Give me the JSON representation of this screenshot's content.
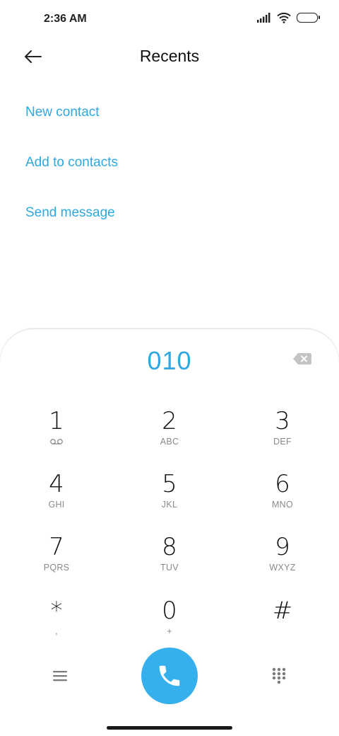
{
  "status_bar": {
    "time": "2:36 AM",
    "icons": [
      "signal-icon",
      "wifi-icon",
      "battery-icon"
    ]
  },
  "header": {
    "back_icon": "back-arrow-icon",
    "title": "Recents"
  },
  "actions": [
    {
      "label": "New contact"
    },
    {
      "label": "Add to contacts"
    },
    {
      "label": "Send message"
    }
  ],
  "dialer": {
    "number": "010",
    "backspace_icon": "backspace-icon",
    "keys": [
      {
        "digit": "1",
        "letters": "",
        "icon": "voicemail-icon"
      },
      {
        "digit": "2",
        "letters": "ABC"
      },
      {
        "digit": "3",
        "letters": "DEF"
      },
      {
        "digit": "4",
        "letters": "GHI"
      },
      {
        "digit": "5",
        "letters": "JKL"
      },
      {
        "digit": "6",
        "letters": "MNO"
      },
      {
        "digit": "7",
        "letters": "PQRS"
      },
      {
        "digit": "8",
        "letters": "TUV"
      },
      {
        "digit": "9",
        "letters": "WXYZ"
      },
      {
        "digit": "*",
        "letters": ","
      },
      {
        "digit": "0",
        "letters": "+"
      },
      {
        "digit": "#",
        "letters": ""
      }
    ],
    "bottom": {
      "menu_icon": "menu-icon",
      "call_icon": "phone-icon",
      "keypad_icon": "dialpad-icon"
    }
  },
  "colors": {
    "accent": "#2fa8e0",
    "call_button": "#35b0ec",
    "text": "#111111",
    "secondary_text": "#8a8a8a"
  }
}
